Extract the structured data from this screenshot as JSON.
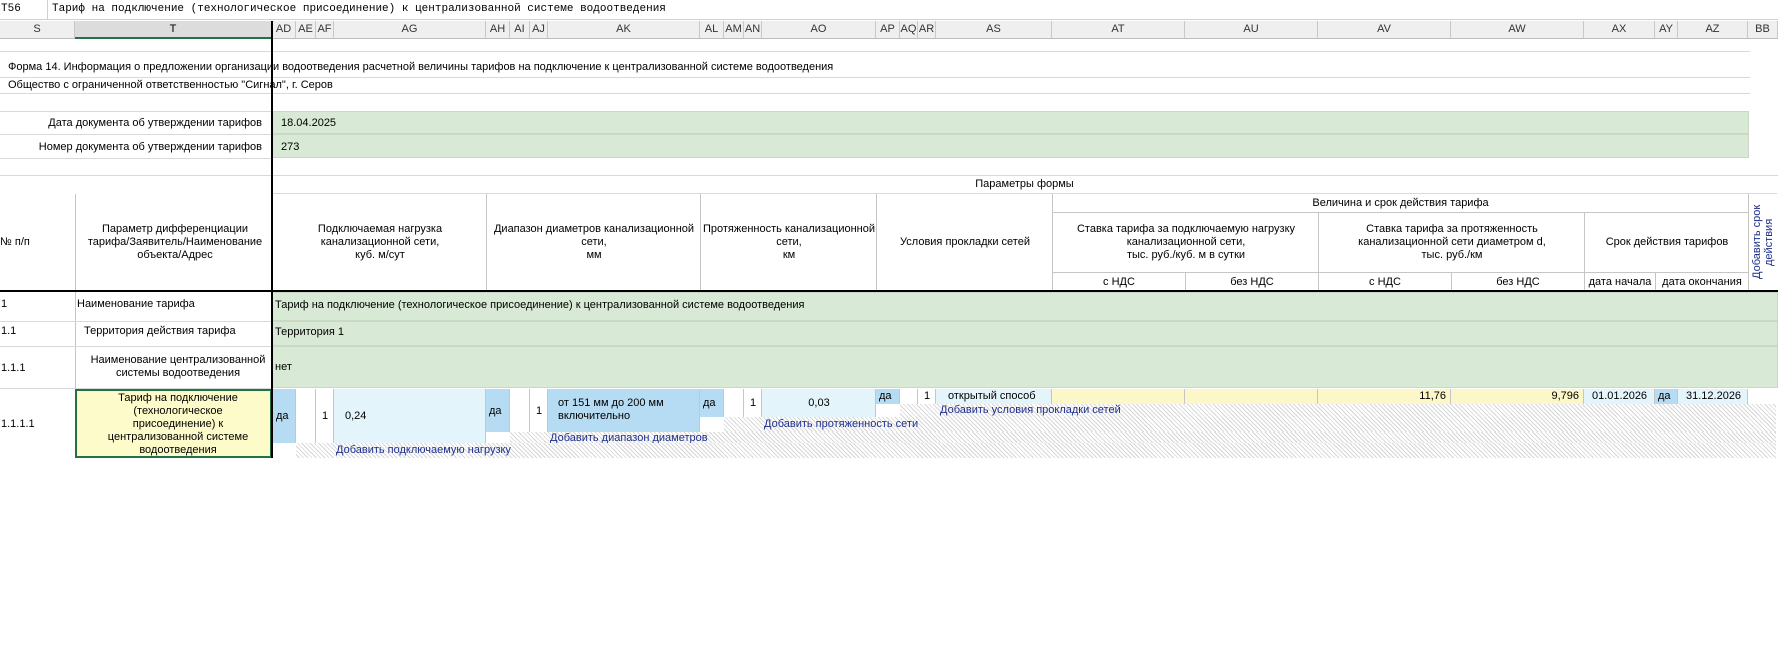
{
  "formula_bar": {
    "cell_ref": "T56",
    "formula": "Тариф на подключение (технологическое присоединение) к централизованной системе водоотведения"
  },
  "columns": [
    {
      "id": "S"
    },
    {
      "id": "T"
    },
    {
      "id": "AD"
    },
    {
      "id": "AE"
    },
    {
      "id": "AF"
    },
    {
      "id": "AG"
    },
    {
      "id": "AH"
    },
    {
      "id": "AI"
    },
    {
      "id": "AJ"
    },
    {
      "id": "AK"
    },
    {
      "id": "AL"
    },
    {
      "id": "AM"
    },
    {
      "id": "AN"
    },
    {
      "id": "AO"
    },
    {
      "id": "AP"
    },
    {
      "id": "AQ"
    },
    {
      "id": "AR"
    },
    {
      "id": "AS"
    },
    {
      "id": "AT"
    },
    {
      "id": "AU"
    },
    {
      "id": "AV"
    },
    {
      "id": "AW"
    },
    {
      "id": "AX"
    },
    {
      "id": "AY"
    },
    {
      "id": "AZ"
    },
    {
      "id": "BB"
    }
  ],
  "form": {
    "title_line": "Форма 14. Информация о предложении организации водоотведения расчетной величины тарифов на подключение к централизованной системе водоотведения",
    "org_line": "Общество с ограниченной ответственностью \"Сигнал\", г. Серов",
    "doc_date_label": "Дата документа об утверждении тарифов",
    "doc_date_value": "18.04.2025",
    "doc_number_label": "Номер документа об утверждении тарифов",
    "doc_number_value": "273"
  },
  "header": {
    "form_params": "Параметры формы",
    "col_num": "№ п/п",
    "col_param": "Параметр дифференциации тарифа/Заявитель/Наименование объекта/Адрес",
    "col_load": "Подключаемая нагрузка канализационной сети,\nкуб. м/сут",
    "col_diam": "Диапазон диаметров канализационной сети,\nмм",
    "col_length": "Протяженность канализационной сети,\nкм",
    "col_cond": "Условия прокладки сетей",
    "col_value_group": "Величина и срок действия тарифа",
    "col_rate_load": "Ставка тарифа за подключаемую нагрузку канализационной сети,\nтыс. руб./куб. м в сутки",
    "col_rate_len": "Ставка тарифа за протяженность канализационной сети диаметром d,\nтыс. руб./км",
    "col_term": "Срок действия тарифов",
    "add_term": "Добавить срок действия",
    "with_vat_1": "с НДС",
    "no_vat_1": "без НДС",
    "with_vat_2": "с НДС",
    "no_vat_2": "без НДС",
    "date_start": "дата начала",
    "date_end": "дата окончания"
  },
  "rows": {
    "r1_num": "1",
    "r1_label": "Наименование тарифа",
    "r1_value": "Тариф на подключение (технологическое присоединение) к централизованной системе водоотведения",
    "r2_num": "1.1",
    "r2_label": "Территория действия тарифа",
    "r2_value": "Территория 1",
    "r3_num": "1.1.1",
    "r3_label": "Наименование централизованной системы водоотведения",
    "r3_value": "нет",
    "r4_num": "1.1.1.1",
    "r4_label": "Тариф на подключение (технологическое присоединение) к централизованной системе водоотведения",
    "load_flag": "да",
    "load_idx": "1",
    "load_value": "0,24",
    "diam_flag": "да",
    "diam_idx": "1",
    "diam_value": "от 151 мм до 200 мм включительно",
    "len_flag": "да",
    "len_idx": "1",
    "len_value": "0,03",
    "cond_flag": "да",
    "cond_idx": "1",
    "cond_value": "открытый способ",
    "rate_len_vat": "11,76",
    "rate_len_novat": "9,796",
    "date_start": "01.01.2026",
    "term_flag": "да",
    "date_end": "31.12.2026",
    "add_cond": "Добавить условия прокладки сетей",
    "add_len": "Добавить протяженность сети",
    "add_diam": "Добавить диапазон диаметров",
    "add_load": "Добавить подключаемую нагрузку"
  }
}
